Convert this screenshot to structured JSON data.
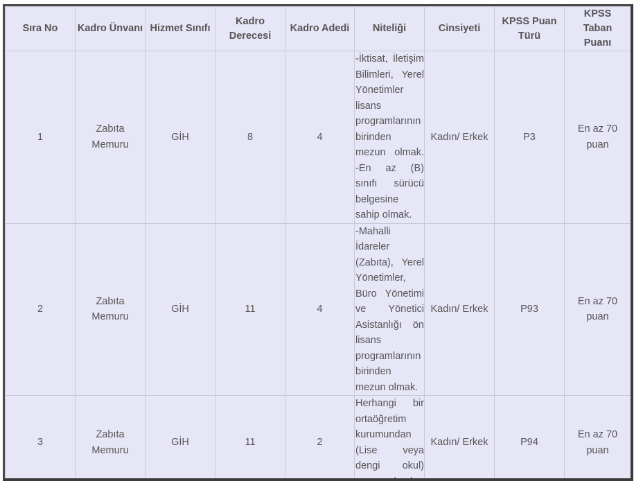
{
  "table": {
    "headers": [
      "Sıra No",
      "Kadro Ünvanı",
      "Hizmet Sınıfı",
      "Kadro Derecesi",
      "Kadro Adedi",
      "Niteliği",
      "Cinsiyeti",
      "KPSS Puan Türü",
      "KPSS Taban Puanı"
    ],
    "rows": [
      {
        "sira_no": "1",
        "kadro_unvani": "Zabıta Memuru",
        "hizmet_sinifi": "GİH",
        "kadro_derecesi": "8",
        "kadro_adedi": "4",
        "niteligi": "-İktisat, İletişim Bilimleri, Yerel Yönetimler lisans programlarının birinden mezun olmak. -En az (B) sınıfı sürücü belgesine sahip olmak.",
        "cinsiyeti": "Kadın/ Erkek",
        "kpss_puan_turu": "P3",
        "kpss_taban_puani": "En az 70 puan"
      },
      {
        "sira_no": "2",
        "kadro_unvani": "Zabıta Memuru",
        "hizmet_sinifi": "GİH",
        "kadro_derecesi": "11",
        "kadro_adedi": "4",
        "niteligi": "-Mahalli İdareler (Zabıta), Yerel Yönetimler, Büro Yönetimi ve Yönetici Asistanlığı ön lisans programlarının birinden mezun olmak.",
        "cinsiyeti": "Kadın/ Erkek",
        "kpss_puan_turu": "P93",
        "kpss_taban_puani": "En az 70 puan"
      },
      {
        "sira_no": "3",
        "kadro_unvani": "Zabıta Memuru",
        "hizmet_sinifi": "GİH",
        "kadro_derecesi": "11",
        "kadro_adedi": "2",
        "niteligi": "Herhangi bir ortaöğretim kurumundan (Lise veya dengi okul) mezun olmak.",
        "cinsiyeti": "Kadın/ Erkek",
        "kpss_puan_turu": "P94",
        "kpss_taban_puani": "En az 70 puan"
      }
    ]
  }
}
